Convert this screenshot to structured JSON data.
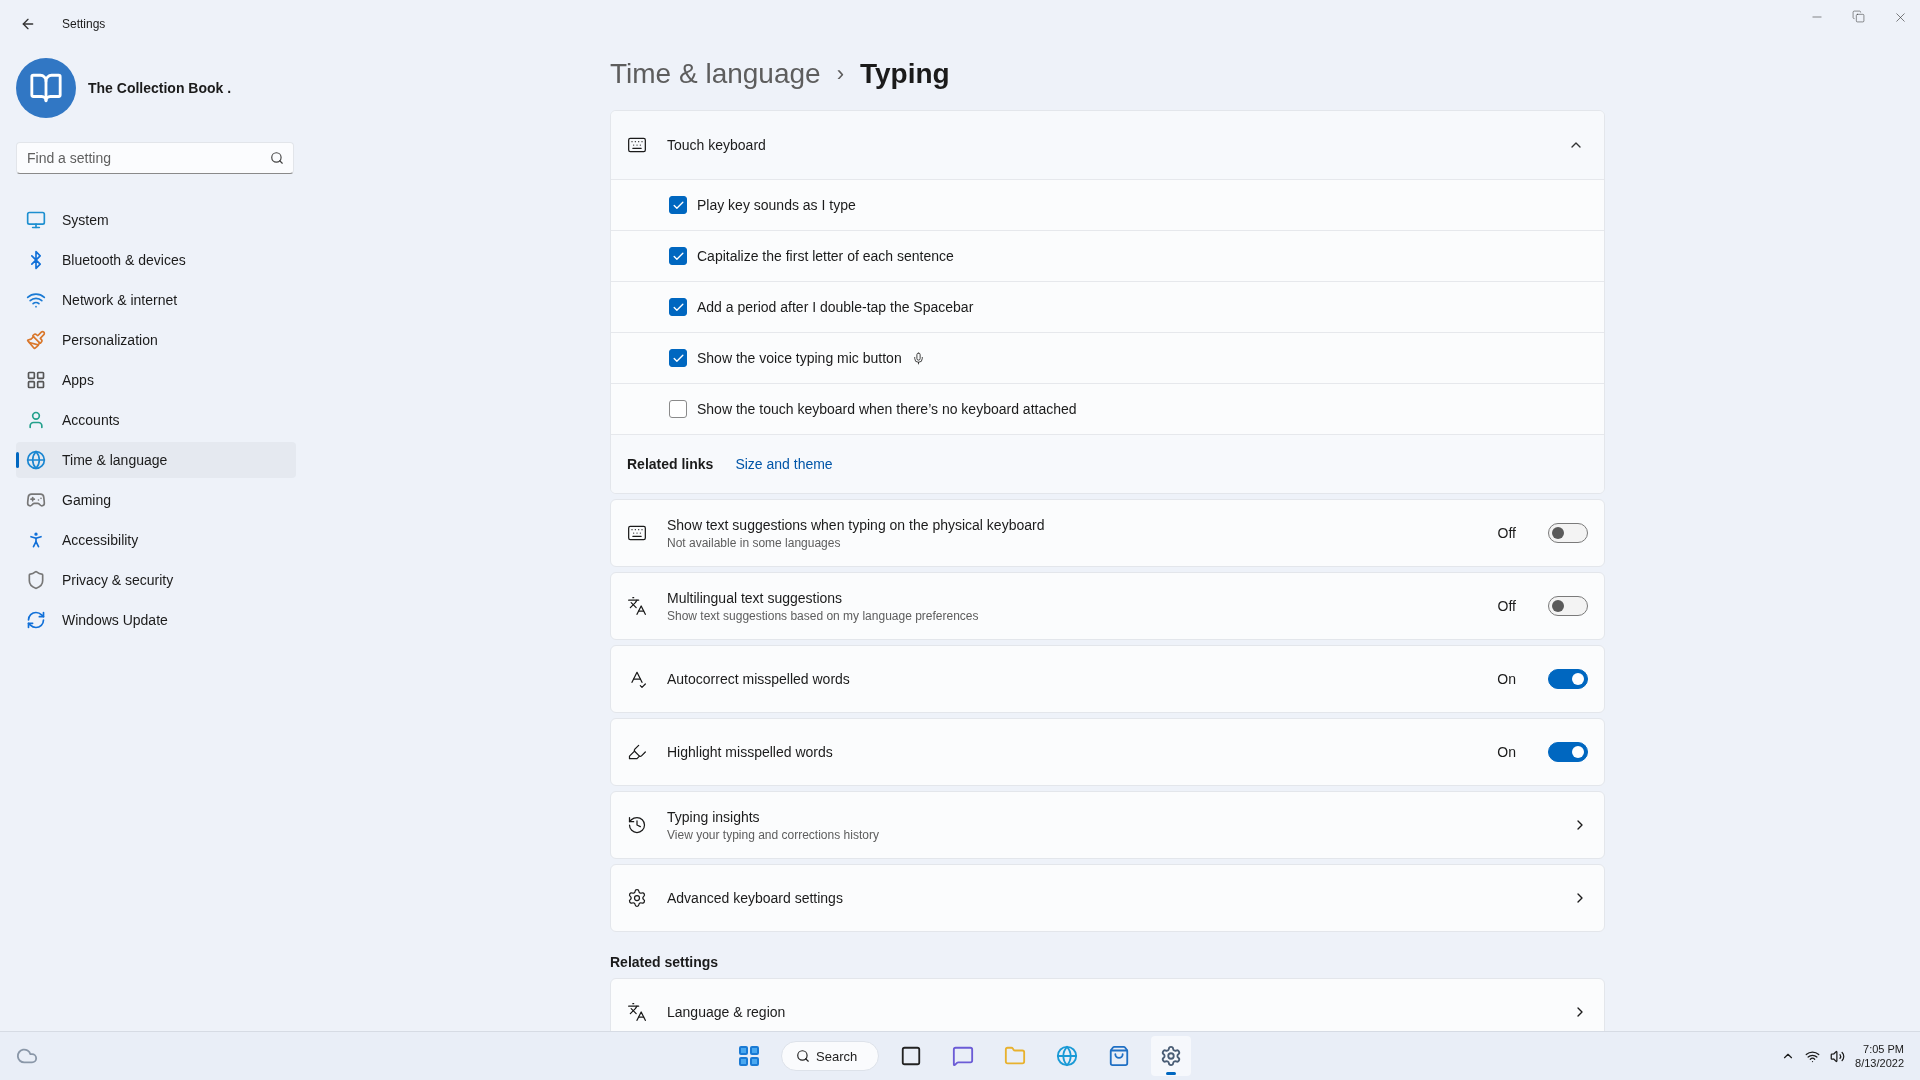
{
  "window": {
    "title": "Settings"
  },
  "user": {
    "name": "The Collection Book ."
  },
  "search": {
    "placeholder": "Find a setting"
  },
  "nav": [
    {
      "kind": "system",
      "label": "System",
      "selected": false
    },
    {
      "kind": "bluetooth",
      "label": "Bluetooth & devices",
      "selected": false
    },
    {
      "kind": "network",
      "label": "Network & internet",
      "selected": false
    },
    {
      "kind": "personalization",
      "label": "Personalization",
      "selected": false
    },
    {
      "kind": "apps",
      "label": "Apps",
      "selected": false
    },
    {
      "kind": "accounts",
      "label": "Accounts",
      "selected": false
    },
    {
      "kind": "time",
      "label": "Time & language",
      "selected": true
    },
    {
      "kind": "gaming",
      "label": "Gaming",
      "selected": false
    },
    {
      "kind": "accessibility",
      "label": "Accessibility",
      "selected": false
    },
    {
      "kind": "privacy",
      "label": "Privacy & security",
      "selected": false
    },
    {
      "kind": "update",
      "label": "Windows Update",
      "selected": false
    }
  ],
  "breadcrumb": {
    "parent": "Time & language",
    "separator": "›",
    "current": "Typing"
  },
  "touch_keyboard": {
    "title": "Touch keyboard",
    "expanded": true,
    "options": [
      {
        "kind": "plain",
        "label": "Play key sounds as I type",
        "checked": true
      },
      {
        "kind": "plain",
        "label": "Capitalize the first letter of each sentence",
        "checked": true
      },
      {
        "kind": "plain",
        "label": "Add a period after I double-tap the Spacebar",
        "checked": true
      },
      {
        "kind": "mic",
        "label": "Show the voice typing mic button",
        "checked": true
      },
      {
        "kind": "plain",
        "label": "Show the touch keyboard when there’s no keyboard attached",
        "checked": false
      }
    ],
    "related_label": "Related links",
    "related_link": "Size and theme"
  },
  "settings": [
    {
      "kind": "toggle",
      "title": "Show text suggestions when typing on the physical keyboard",
      "subtitle": "Not available in some languages",
      "on": false,
      "state_label": "Off"
    },
    {
      "kind": "toggle",
      "title": "Multilingual text suggestions",
      "subtitle": "Show text suggestions based on my language preferences",
      "on": false,
      "state_label": "Off"
    },
    {
      "kind": "toggle",
      "title": "Autocorrect misspelled words",
      "on": true,
      "state_label": "On"
    },
    {
      "kind": "toggle",
      "title": "Highlight misspelled words",
      "on": true,
      "state_label": "On"
    },
    {
      "kind": "link",
      "title": "Typing insights",
      "subtitle": "View your typing and corrections history"
    },
    {
      "kind": "link",
      "title": "Advanced keyboard settings"
    }
  ],
  "related_settings": {
    "heading": "Related settings",
    "items": [
      {
        "title": "Language & region"
      }
    ]
  },
  "taskbar": {
    "search": "Search",
    "time": "7:05 PM",
    "date": "8/13/2022",
    "apps": [
      {
        "kind": "files",
        "active": false
      },
      {
        "kind": "chat",
        "active": false
      },
      {
        "kind": "explorer",
        "active": false
      },
      {
        "kind": "browser",
        "active": false
      },
      {
        "kind": "store",
        "active": false
      },
      {
        "kind": "settings",
        "active": true
      }
    ]
  }
}
